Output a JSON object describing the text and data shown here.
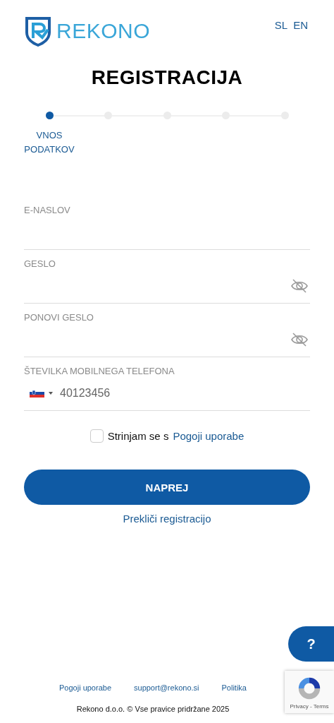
{
  "header": {
    "logo_text": "REKONO",
    "languages": [
      "SL",
      "EN"
    ]
  },
  "title": "REGISTRACIJA",
  "steps": [
    {
      "label": "VNOS PODATKOV",
      "selected": true
    },
    {
      "selected": false
    },
    {
      "selected": false
    },
    {
      "selected": false
    },
    {
      "selected": false
    }
  ],
  "fields": [
    {
      "kind": "text",
      "label": "E-NASLOV"
    },
    {
      "kind": "password",
      "label": "GESLO"
    },
    {
      "kind": "password",
      "label": "PONOVI GESLO"
    },
    {
      "kind": "phone",
      "label": "ŠTEVILKA MOBILNEGA TELEFONA",
      "value": "40123456"
    }
  ],
  "terms": {
    "checked": false,
    "text": "Strinjam se s",
    "link": "Pogoji uporabe"
  },
  "primary_button": "NAPREJ",
  "cancel_link": "Prekliči registracijo",
  "help_button": "?",
  "footer": {
    "links": [
      "Pogoji uporabe",
      "support@rekono.si",
      "Politika"
    ],
    "copyright": "Rekono d.o.o. © Vse pravice pridržane 2025"
  },
  "recaptcha": {
    "text": "Privacy - Terms"
  }
}
